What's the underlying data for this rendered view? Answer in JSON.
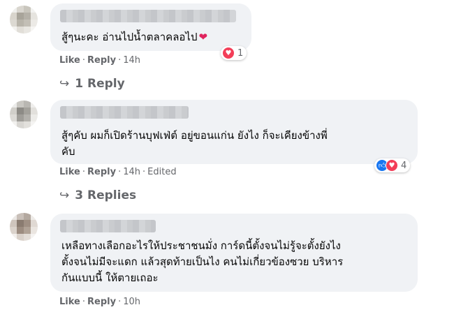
{
  "comments": [
    {
      "text_lines": [
        "สู้ๆนะคะ อ่านไปน้ำตลาคลอไป"
      ],
      "heart_emoji": "❤",
      "reaction_count": "1",
      "reactions": [
        "love"
      ],
      "actions": {
        "like": "Like",
        "reply": "Reply",
        "time": "14h"
      },
      "replies_label": "1 Reply"
    },
    {
      "text_lines": [
        "สู้ๆคับ ผมก็เปิดร้านบุฟเฟ่ต์ อยู่ขอนแก่น ยังไง ก็จะเคียงข้างพี่",
        "คับ"
      ],
      "reaction_count": "4",
      "reactions": [
        "like",
        "love"
      ],
      "actions": {
        "like": "Like",
        "reply": "Reply",
        "time": "14h",
        "edited": "Edited"
      },
      "replies_label": "3 Replies"
    },
    {
      "text_lines": [
        "เหลือทางเลือกอะไรให้ประชาชนมั่ง การ์ดนี้ตั้งจนไม่รู้จะตั้งยังไง",
        "ตั้งจนไม่มีจะแดก แล้วสุดท้ายเป็นไง คนไม่เกี่ยวข้องซวย บริหาร",
        "กันแบบนี้ ให้ตายเถอะ"
      ],
      "actions": {
        "like": "Like",
        "reply": "Reply",
        "time": "10h"
      }
    }
  ],
  "icons": {
    "reply_arrow": "reply-arrow-icon",
    "love": "love-reaction-icon",
    "like": "like-reaction-icon"
  },
  "colors": {
    "bubble": "#f0f2f5",
    "meta": "#65676b",
    "love": "#f33e58",
    "like": "#1877f2"
  }
}
